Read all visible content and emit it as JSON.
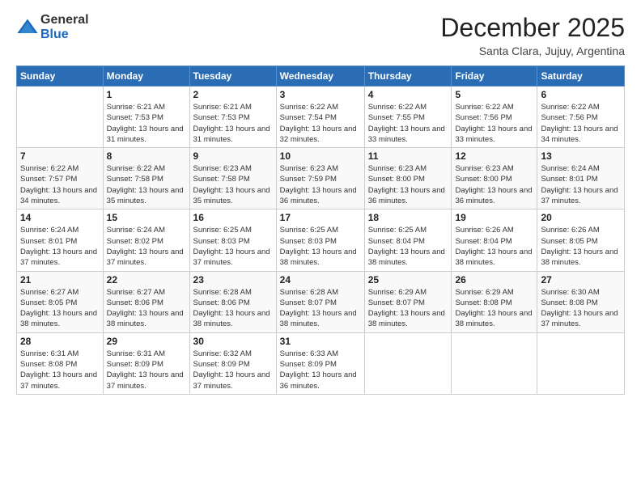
{
  "logo": {
    "general": "General",
    "blue": "Blue"
  },
  "title": "December 2025",
  "location": "Santa Clara, Jujuy, Argentina",
  "days_of_week": [
    "Sunday",
    "Monday",
    "Tuesday",
    "Wednesday",
    "Thursday",
    "Friday",
    "Saturday"
  ],
  "weeks": [
    [
      {
        "day": "",
        "info": ""
      },
      {
        "day": "1",
        "info": "Sunrise: 6:21 AM\nSunset: 7:53 PM\nDaylight: 13 hours and 31 minutes."
      },
      {
        "day": "2",
        "info": "Sunrise: 6:21 AM\nSunset: 7:53 PM\nDaylight: 13 hours and 31 minutes."
      },
      {
        "day": "3",
        "info": "Sunrise: 6:22 AM\nSunset: 7:54 PM\nDaylight: 13 hours and 32 minutes."
      },
      {
        "day": "4",
        "info": "Sunrise: 6:22 AM\nSunset: 7:55 PM\nDaylight: 13 hours and 33 minutes."
      },
      {
        "day": "5",
        "info": "Sunrise: 6:22 AM\nSunset: 7:56 PM\nDaylight: 13 hours and 33 minutes."
      },
      {
        "day": "6",
        "info": "Sunrise: 6:22 AM\nSunset: 7:56 PM\nDaylight: 13 hours and 34 minutes."
      }
    ],
    [
      {
        "day": "7",
        "info": "Sunrise: 6:22 AM\nSunset: 7:57 PM\nDaylight: 13 hours and 34 minutes."
      },
      {
        "day": "8",
        "info": "Sunrise: 6:22 AM\nSunset: 7:58 PM\nDaylight: 13 hours and 35 minutes."
      },
      {
        "day": "9",
        "info": "Sunrise: 6:23 AM\nSunset: 7:58 PM\nDaylight: 13 hours and 35 minutes."
      },
      {
        "day": "10",
        "info": "Sunrise: 6:23 AM\nSunset: 7:59 PM\nDaylight: 13 hours and 36 minutes."
      },
      {
        "day": "11",
        "info": "Sunrise: 6:23 AM\nSunset: 8:00 PM\nDaylight: 13 hours and 36 minutes."
      },
      {
        "day": "12",
        "info": "Sunrise: 6:23 AM\nSunset: 8:00 PM\nDaylight: 13 hours and 36 minutes."
      },
      {
        "day": "13",
        "info": "Sunrise: 6:24 AM\nSunset: 8:01 PM\nDaylight: 13 hours and 37 minutes."
      }
    ],
    [
      {
        "day": "14",
        "info": "Sunrise: 6:24 AM\nSunset: 8:01 PM\nDaylight: 13 hours and 37 minutes."
      },
      {
        "day": "15",
        "info": "Sunrise: 6:24 AM\nSunset: 8:02 PM\nDaylight: 13 hours and 37 minutes."
      },
      {
        "day": "16",
        "info": "Sunrise: 6:25 AM\nSunset: 8:03 PM\nDaylight: 13 hours and 37 minutes."
      },
      {
        "day": "17",
        "info": "Sunrise: 6:25 AM\nSunset: 8:03 PM\nDaylight: 13 hours and 38 minutes."
      },
      {
        "day": "18",
        "info": "Sunrise: 6:25 AM\nSunset: 8:04 PM\nDaylight: 13 hours and 38 minutes."
      },
      {
        "day": "19",
        "info": "Sunrise: 6:26 AM\nSunset: 8:04 PM\nDaylight: 13 hours and 38 minutes."
      },
      {
        "day": "20",
        "info": "Sunrise: 6:26 AM\nSunset: 8:05 PM\nDaylight: 13 hours and 38 minutes."
      }
    ],
    [
      {
        "day": "21",
        "info": "Sunrise: 6:27 AM\nSunset: 8:05 PM\nDaylight: 13 hours and 38 minutes."
      },
      {
        "day": "22",
        "info": "Sunrise: 6:27 AM\nSunset: 8:06 PM\nDaylight: 13 hours and 38 minutes."
      },
      {
        "day": "23",
        "info": "Sunrise: 6:28 AM\nSunset: 8:06 PM\nDaylight: 13 hours and 38 minutes."
      },
      {
        "day": "24",
        "info": "Sunrise: 6:28 AM\nSunset: 8:07 PM\nDaylight: 13 hours and 38 minutes."
      },
      {
        "day": "25",
        "info": "Sunrise: 6:29 AM\nSunset: 8:07 PM\nDaylight: 13 hours and 38 minutes."
      },
      {
        "day": "26",
        "info": "Sunrise: 6:29 AM\nSunset: 8:08 PM\nDaylight: 13 hours and 38 minutes."
      },
      {
        "day": "27",
        "info": "Sunrise: 6:30 AM\nSunset: 8:08 PM\nDaylight: 13 hours and 37 minutes."
      }
    ],
    [
      {
        "day": "28",
        "info": "Sunrise: 6:31 AM\nSunset: 8:08 PM\nDaylight: 13 hours and 37 minutes."
      },
      {
        "day": "29",
        "info": "Sunrise: 6:31 AM\nSunset: 8:09 PM\nDaylight: 13 hours and 37 minutes."
      },
      {
        "day": "30",
        "info": "Sunrise: 6:32 AM\nSunset: 8:09 PM\nDaylight: 13 hours and 37 minutes."
      },
      {
        "day": "31",
        "info": "Sunrise: 6:33 AM\nSunset: 8:09 PM\nDaylight: 13 hours and 36 minutes."
      },
      {
        "day": "",
        "info": ""
      },
      {
        "day": "",
        "info": ""
      },
      {
        "day": "",
        "info": ""
      }
    ]
  ]
}
